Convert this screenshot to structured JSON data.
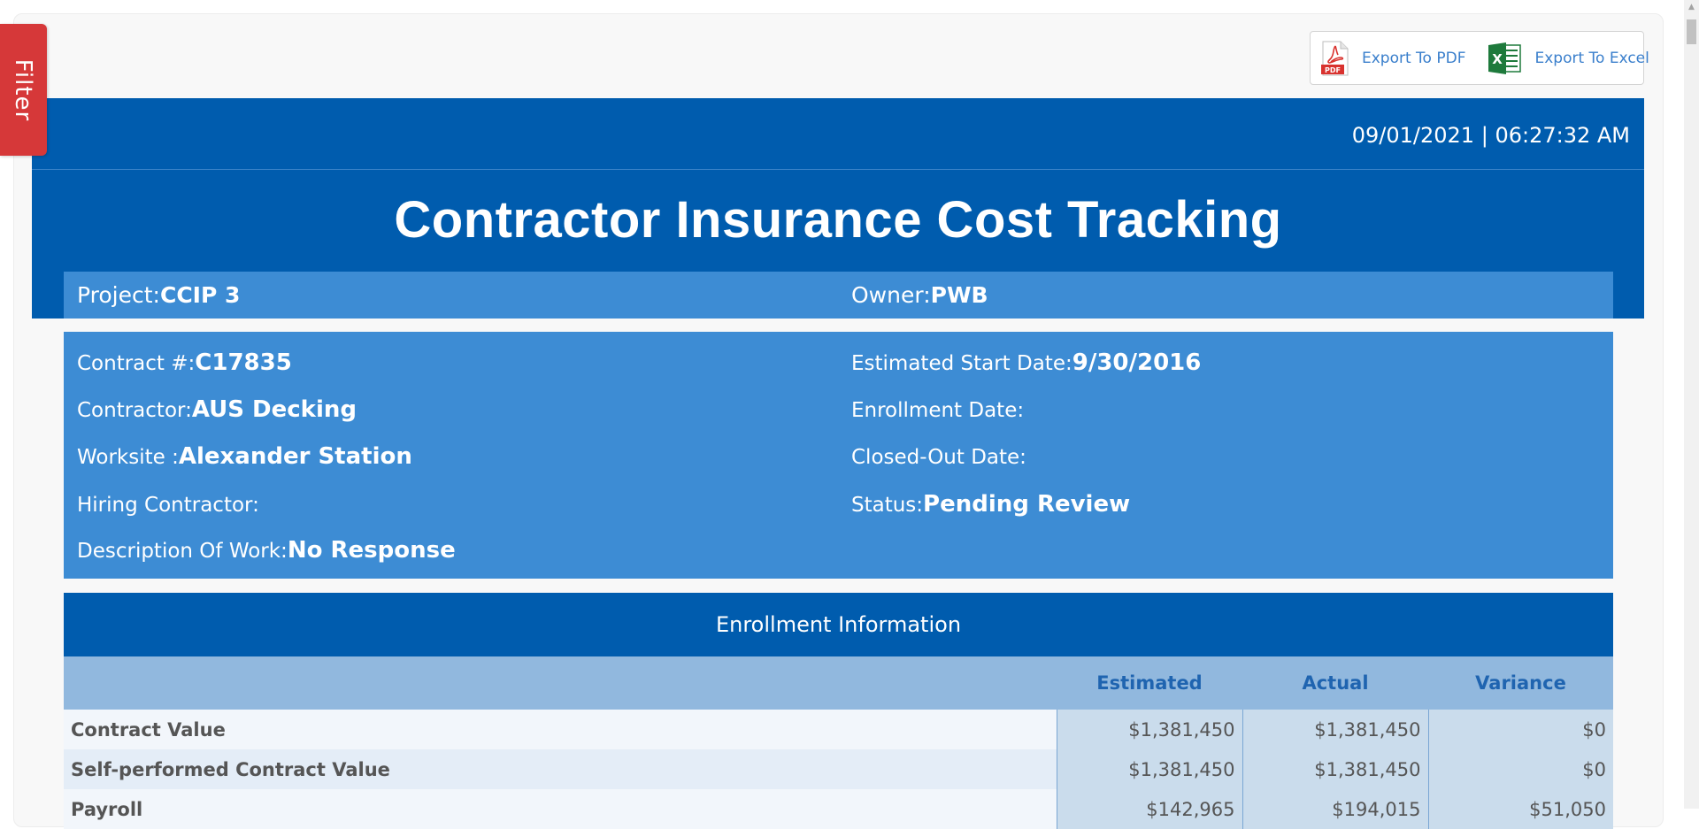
{
  "filter": {
    "label": "Filter"
  },
  "export": {
    "pdf_label": "Export To PDF",
    "pdf_icon_text": "PDF",
    "excel_label": "Export To Excel",
    "excel_icon_text": "X"
  },
  "header": {
    "date": "09/01/2021",
    "separator": "|",
    "time": "06:27:32 AM",
    "title": "Contractor Insurance Cost Tracking"
  },
  "project": {
    "project_label": "Project:",
    "project_value": "CCIP 3",
    "owner_label": "Owner:",
    "owner_value": "PWB"
  },
  "details": {
    "contract_label": "Contract #:",
    "contract_value": "C17835",
    "contractor_label": "Contractor:",
    "contractor_value": "AUS Decking",
    "worksite_label": "Worksite :",
    "worksite_value": "Alexander Station",
    "hiring_label": "Hiring Contractor:",
    "hiring_value": "",
    "description_label": "Description Of Work:",
    "description_value": "No Response",
    "start_label": "Estimated Start Date:",
    "start_value": "9/30/2016",
    "enrollment_label": "Enrollment Date:",
    "enrollment_value": "",
    "closed_label": "Closed-Out Date:",
    "closed_value": "",
    "status_label": "Status:",
    "status_value": "Pending Review"
  },
  "enrollment": {
    "title": "Enrollment Information",
    "columns": [
      "",
      "Estimated",
      "Actual",
      "Variance"
    ],
    "rows": [
      {
        "label": "Contract Value",
        "estimated": "$1,381,450",
        "actual": "$1,381,450",
        "variance": "$0"
      },
      {
        "label": "Self-performed Contract Value",
        "estimated": "$1,381,450",
        "actual": "$1,381,450",
        "variance": "$0"
      },
      {
        "label": "Payroll",
        "estimated": "$142,965",
        "actual": "$194,015",
        "variance": "$51,050"
      }
    ]
  },
  "colors": {
    "header_blue": "#005cae",
    "panel_blue": "#3d8cd4",
    "filter_red": "#d63839",
    "link_blue": "#3a7fcc"
  }
}
